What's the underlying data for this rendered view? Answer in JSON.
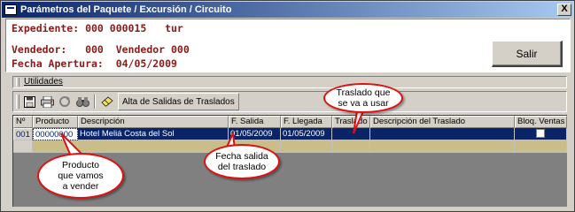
{
  "window": {
    "title": "Parámetros del Paquete / Excursión / Circuito",
    "close_label": "X"
  },
  "header": {
    "expediente": "Expediente: 000 000015   tur",
    "vendedor": "Vendedor:   000  Vendedor 000",
    "fecha_apertura": "Fecha Apertura:  04/05/2009",
    "salir_label": "Salir"
  },
  "menu": {
    "utilidades_label": "Utilidades"
  },
  "toolbar": {
    "icons": [
      "save-icon",
      "printer-icon",
      "refresh-icon",
      "binoculars-icon",
      "eraser-icon"
    ],
    "alta_label": "Alta de Salidas de Traslados"
  },
  "grid": {
    "columns": [
      "Nº",
      "Producto",
      "Descripción",
      "F. Salida",
      "F. Llegada",
      "Traslado",
      "Descripción del Traslado",
      "Bloq. Ventas"
    ],
    "rows": [
      {
        "num": "001",
        "producto": "00000000",
        "descripcion": "Hotel Meliá Costa del Sol",
        "f_salida": "01/05/2009",
        "f_llegada": "01/05/2009",
        "traslado": "",
        "desc_traslado": "",
        "bloq_ventas": false
      }
    ]
  },
  "callouts": {
    "traslado": "Traslado que se va a usar",
    "producto": "Producto que vamos a vender",
    "fecha": "Fecha salida del traslado"
  },
  "colors": {
    "title_gradient_start": "#0a246a",
    "header_text": "#8b1a1a",
    "selected_row": "#0a246a",
    "empty_row": "#cbbd87",
    "callout_border": "#e01010"
  }
}
